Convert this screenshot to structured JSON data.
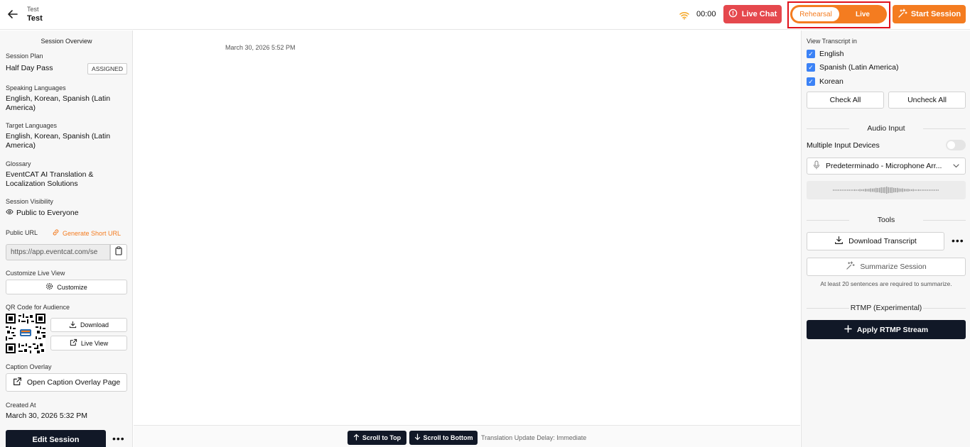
{
  "header": {
    "back_icon": "arrow-left-icon",
    "title_small": "Test",
    "title_main": "Test",
    "signal_icon": "wifi-icon",
    "timer": "00:00",
    "live_chat_label": "Live Chat",
    "mode_rehearsal": "Rehearsal",
    "mode_live": "Live",
    "start_session_label": "Start Session",
    "colors": {
      "accent": "#f47c20",
      "danger": "#e5484d",
      "highlight_box": "#e0101a"
    }
  },
  "left": {
    "section_title": "Session Overview",
    "session_plan_label": "Session Plan",
    "session_plan_value": "Half Day Pass",
    "session_plan_badge": "ASSIGNED",
    "speaking_label": "Speaking Languages",
    "speaking_value": "English, Korean, Spanish (Latin America)",
    "target_label": "Target Languages",
    "target_value": "English, Korean, Spanish (Latin America)",
    "glossary_label": "Glossary",
    "glossary_value": "EventCAT AI Translation & Localization Solutions",
    "visibility_label": "Session Visibility",
    "visibility_value": "Public to Everyone",
    "public_url_label": "Public URL",
    "generate_short_url": "Generate Short URL",
    "public_url_value": "https://app.eventcat.com/se",
    "customize_label": "Customize Live View",
    "customize_button": "Customize",
    "qr_label": "QR Code for Audience",
    "download_button": "Download",
    "live_view_button": "Live View",
    "caption_label": "Caption Overlay",
    "caption_button": "Open Caption Overlay Page",
    "created_label": "Created At",
    "created_value": "March 30, 2026 5:32 PM",
    "edit_session_button": "Edit Session",
    "more_label": "•••"
  },
  "center": {
    "timestamp": "March 30, 2026 5:52 PM",
    "scroll_top": "Scroll to Top",
    "scroll_bottom": "Scroll to Bottom",
    "delay_text": "Translation Update Delay: Immediate"
  },
  "right": {
    "view_transcript_label": "View Transcript in",
    "languages": [
      "English",
      "Spanish (Latin America)",
      "Korean"
    ],
    "check_all": "Check All",
    "uncheck_all": "Uncheck All",
    "audio_input_title": "Audio Input",
    "multiple_devices_label": "Multiple Input Devices",
    "device_value": "Predeterminado - Microphone Arr...",
    "tools_title": "Tools",
    "download_transcript": "Download Transcript",
    "more_label": "•••",
    "summarize": "Summarize Session",
    "summarize_note": "At least 20 sentences are required to summarize.",
    "rtmp_title": "RTMP (Experimental)",
    "apply_rtmp": "Apply RTMP Stream"
  }
}
